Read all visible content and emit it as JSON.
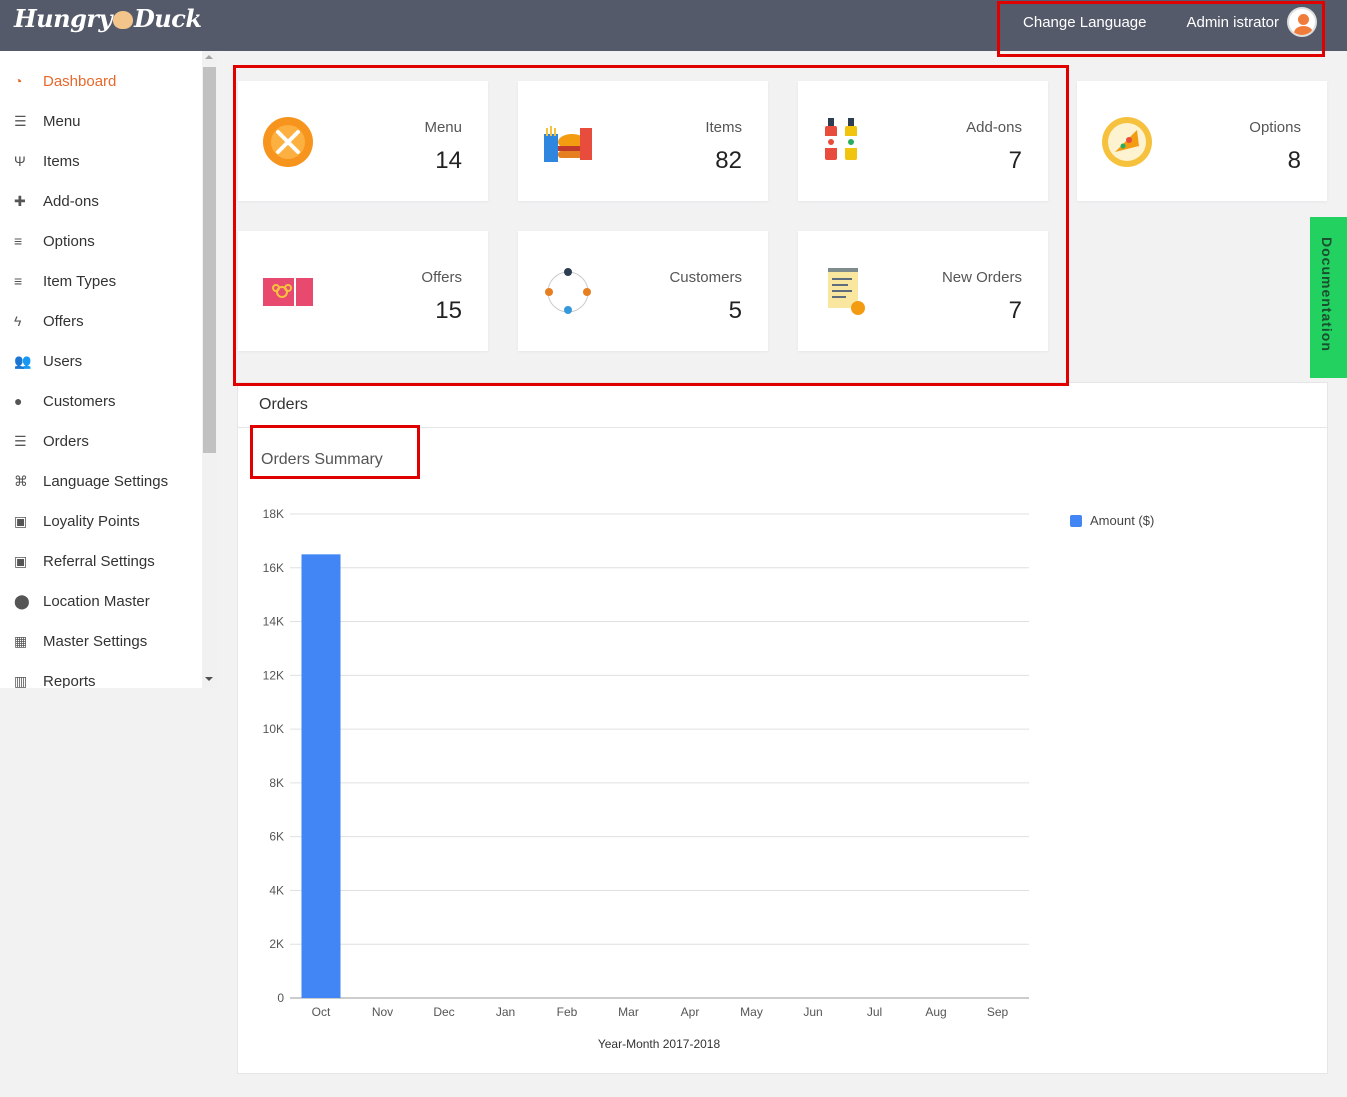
{
  "header": {
    "logo_left": "Hungry",
    "logo_right": "Duck",
    "change_language": "Change Language",
    "user_name": "Admin istrator"
  },
  "sidebar": {
    "items": [
      {
        "label": "Dashboard",
        "icon": "dashboard-icon",
        "active": true
      },
      {
        "label": "Menu",
        "icon": "menu-icon"
      },
      {
        "label": "Items",
        "icon": "cutlery-icon"
      },
      {
        "label": "Add-ons",
        "icon": "plus-icon"
      },
      {
        "label": "Options",
        "icon": "list-icon"
      },
      {
        "label": "Item Types",
        "icon": "list-icon"
      },
      {
        "label": "Offers",
        "icon": "bolt-icon"
      },
      {
        "label": "Users",
        "icon": "users-icon"
      },
      {
        "label": "Customers",
        "icon": "user-icon"
      },
      {
        "label": "Orders",
        "icon": "list-lines-icon"
      },
      {
        "label": "Language Settings",
        "icon": "language-icon"
      },
      {
        "label": "Loyality Points",
        "icon": "gift-icon"
      },
      {
        "label": "Referral Settings",
        "icon": "gift-icon"
      },
      {
        "label": "Location Master",
        "icon": "map-marker-icon"
      },
      {
        "label": "Master Settings",
        "icon": "qrcode-icon"
      },
      {
        "label": "Reports",
        "icon": "bar-chart-icon"
      }
    ]
  },
  "cards": [
    {
      "label": "Menu",
      "count": "14",
      "icon": "plate-fork-knife-icon"
    },
    {
      "label": "Items",
      "count": "82",
      "icon": "fastfood-icon"
    },
    {
      "label": "Add-ons",
      "count": "7",
      "icon": "sauce-bottles-icon"
    },
    {
      "label": "Options",
      "count": "8",
      "icon": "pizza-slice-icon"
    },
    {
      "label": "Offers",
      "count": "15",
      "icon": "gift-ticket-icon"
    },
    {
      "label": "Customers",
      "count": "5",
      "icon": "customers-network-icon"
    },
    {
      "label": "New Orders",
      "count": "7",
      "icon": "order-list-icon"
    }
  ],
  "documentation": "Documentation",
  "orders": {
    "panel_title": "Orders",
    "summary_title": "Orders Summary"
  },
  "chart_data": {
    "type": "bar",
    "categories": [
      "Oct",
      "Nov",
      "Dec",
      "Jan",
      "Feb",
      "Mar",
      "Apr",
      "May",
      "Jun",
      "Jul",
      "Aug",
      "Sep"
    ],
    "series": [
      {
        "name": "Amount ($)",
        "values": [
          16500,
          0,
          0,
          0,
          0,
          0,
          0,
          0,
          0,
          0,
          0,
          0
        ],
        "color": "#4285f4"
      }
    ],
    "xlabel": "Year-Month 2017-2018",
    "ylabel": "",
    "ylim": [
      0,
      18000
    ],
    "yticks": [
      "0",
      "2K",
      "4K",
      "6K",
      "8K",
      "10K",
      "12K",
      "14K",
      "16K",
      "18K"
    ],
    "grid": true,
    "legend": "right"
  }
}
